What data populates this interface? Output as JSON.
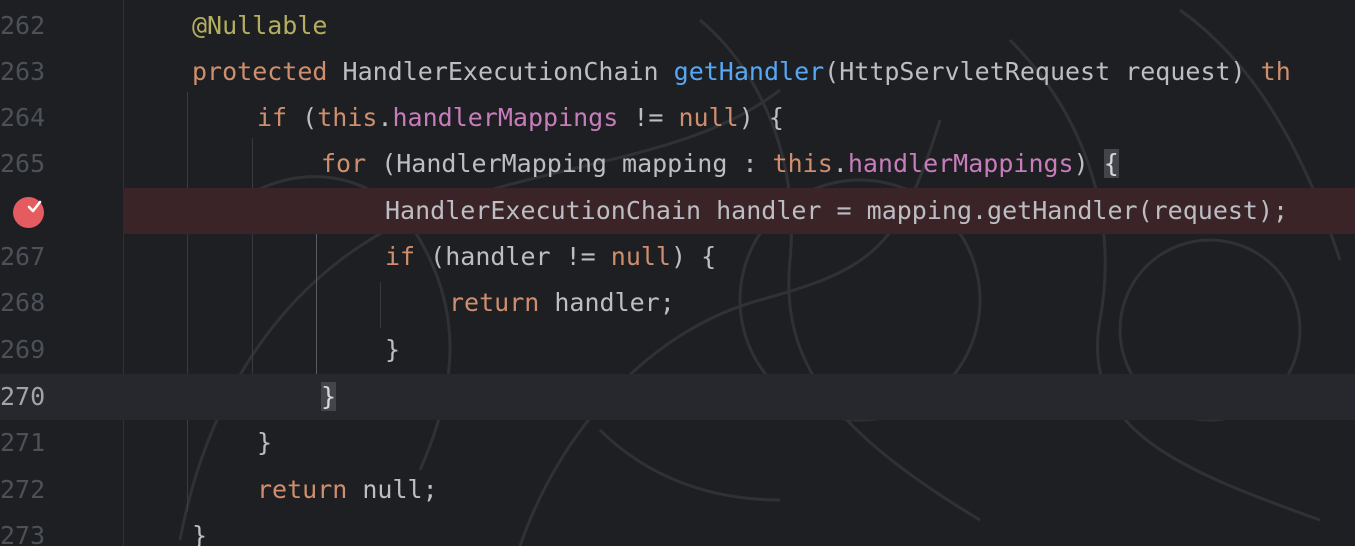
{
  "editor": {
    "lines": [
      {
        "number": "262",
        "tokens": [
          {
            "text": "@Nullable",
            "kind": "annotation"
          }
        ]
      },
      {
        "number": "263",
        "tokens": [
          {
            "text": "protected",
            "kind": "keyword"
          },
          {
            "text": " HandlerExecutionChain ",
            "kind": "plain"
          },
          {
            "text": "getHandler",
            "kind": "function"
          },
          {
            "text": "(HttpServletRequest request) ",
            "kind": "plain"
          },
          {
            "text": "th",
            "kind": "keyword"
          }
        ]
      },
      {
        "number": "264",
        "tokens": [
          {
            "text": "if",
            "kind": "keyword"
          },
          {
            "text": " (",
            "kind": "plain"
          },
          {
            "text": "this",
            "kind": "keyword"
          },
          {
            "text": ".",
            "kind": "plain"
          },
          {
            "text": "handlerMappings",
            "kind": "field"
          },
          {
            "text": " != ",
            "kind": "plain"
          },
          {
            "text": "null",
            "kind": "keyword"
          },
          {
            "text": ") {",
            "kind": "plain"
          }
        ]
      },
      {
        "number": "265",
        "tokens": [
          {
            "text": "for",
            "kind": "keyword"
          },
          {
            "text": " (HandlerMapping mapping : ",
            "kind": "plain"
          },
          {
            "text": "this",
            "kind": "keyword"
          },
          {
            "text": ".",
            "kind": "plain"
          },
          {
            "text": "handlerMappings",
            "kind": "field"
          },
          {
            "text": ") ",
            "kind": "plain"
          },
          {
            "text": "{",
            "kind": "bracket-highlight"
          }
        ]
      },
      {
        "number": "266",
        "tokens": [
          {
            "text": "HandlerExecutionChain handler = mapping.getHandler(request);",
            "kind": "plain"
          }
        ]
      },
      {
        "number": "267",
        "tokens": [
          {
            "text": "if",
            "kind": "keyword"
          },
          {
            "text": " (handler != ",
            "kind": "plain"
          },
          {
            "text": "null",
            "kind": "keyword"
          },
          {
            "text": ") {",
            "kind": "plain"
          }
        ]
      },
      {
        "number": "268",
        "tokens": [
          {
            "text": "return",
            "kind": "keyword"
          },
          {
            "text": " handler;",
            "kind": "plain"
          }
        ]
      },
      {
        "number": "269",
        "tokens": [
          {
            "text": "}",
            "kind": "plain"
          }
        ]
      },
      {
        "number": "270",
        "tokens": [
          {
            "text": "}",
            "kind": "bracket-highlight"
          }
        ]
      },
      {
        "number": "271",
        "tokens": [
          {
            "text": "}",
            "kind": "plain"
          }
        ]
      },
      {
        "number": "272",
        "tokens": [
          {
            "text": "return",
            "kind": "keyword"
          },
          {
            "text": " null;",
            "kind": "plain"
          }
        ]
      },
      {
        "number": "273",
        "tokens": [
          {
            "text": "}",
            "kind": "plain"
          }
        ]
      }
    ],
    "breakpoint_line": "266",
    "breakpoint_icon": "breakpoint-verified-icon",
    "current_line": "270"
  },
  "colors": {
    "background": "#1e1f22",
    "keyword": "#cf8e6d",
    "function": "#56a8f5",
    "field": "#c77dbb",
    "annotation": "#b3ae60",
    "plain": "#bcbec4",
    "line_number": "#4b5059",
    "breakpoint": "#e55b5f",
    "breakpoint_line_bg": "#3a2427"
  }
}
